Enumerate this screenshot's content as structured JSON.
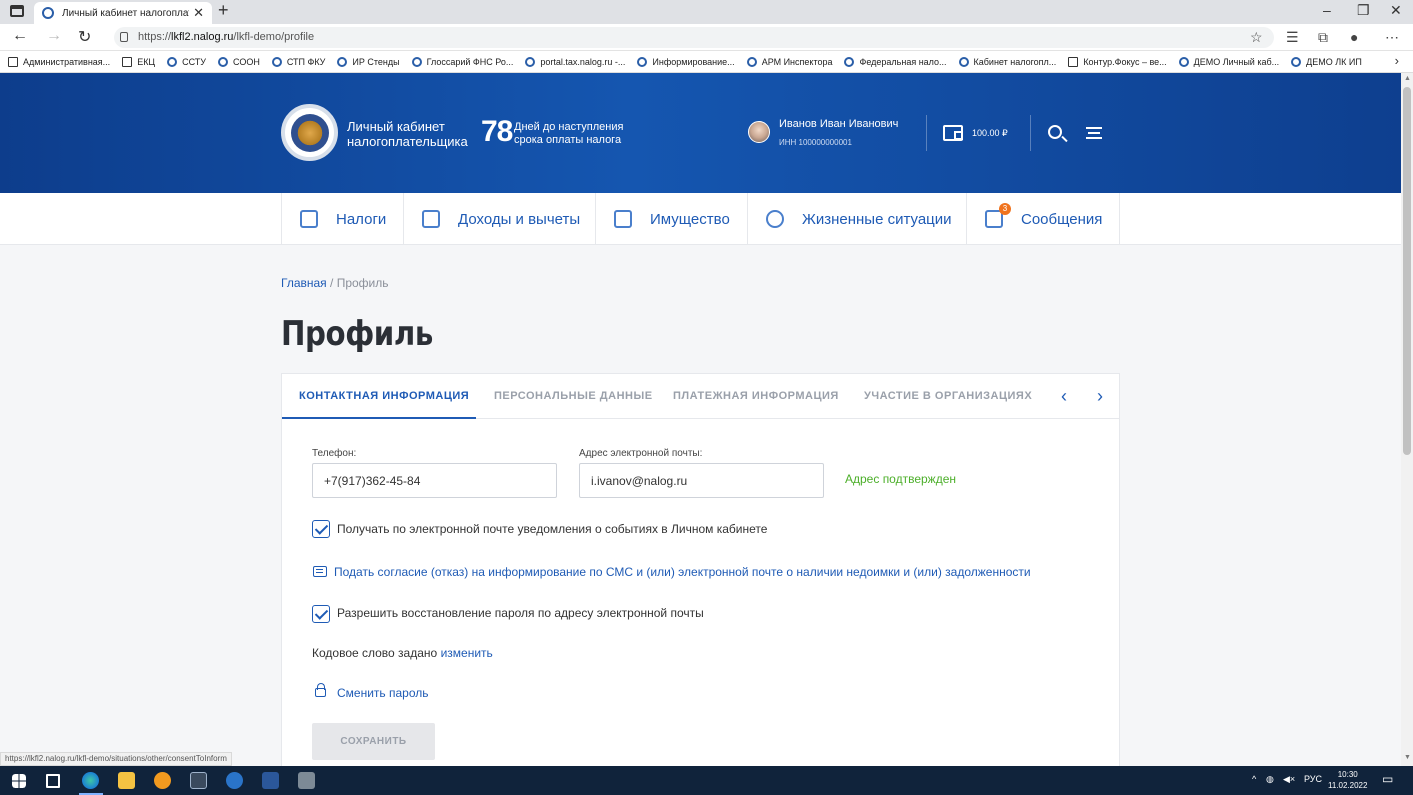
{
  "browser": {
    "tab_title": "Личный кабинет налогоплательщика",
    "url_prefix": "https://",
    "url_host": "lkfl2.nalog.ru",
    "url_path": "/lkfl-demo/profile",
    "bookmarks": [
      "Административная...",
      "ЕКЦ",
      "ССТУ",
      "СООН",
      "СТП ФКУ",
      "ИР Стенды",
      "Глоссарий ФНС Ро...",
      "portal.tax.nalog.ru -...",
      "Информирование...",
      "АРМ Инспектора",
      "Федеральная нало...",
      "Кабинет налогопл...",
      "Контур.Фокус – ве...",
      "ДЕМО Личный каб...",
      "ДЕМО ЛК ИП"
    ],
    "status_url": "https://lkfl2.nalog.ru/lkfl-demo/situations/other/consentToInform"
  },
  "header": {
    "brand_line1": "Личный кабинет",
    "brand_line2": "налогоплательщика",
    "days_count": "78",
    "days_line1": "Дней до наступления",
    "days_line2": "срока оплаты налога",
    "user_name": "Иванов Иван Иванович",
    "user_inn": "ИНН 100000000001",
    "balance": "100.00 ₽"
  },
  "nav": {
    "items": [
      {
        "label": "Налоги"
      },
      {
        "label": "Доходы и вычеты"
      },
      {
        "label": "Имущество"
      },
      {
        "label": "Жизненные ситуации"
      },
      {
        "label": "Сообщения",
        "badge": "3"
      }
    ]
  },
  "breadcrumb": {
    "home": "Главная",
    "separator": " / ",
    "current": "Профиль"
  },
  "page_title": "Профиль",
  "profile_tabs": [
    "КОНТАКТНАЯ ИНФОРМАЦИЯ",
    "ПЕРСОНАЛЬНЫЕ ДАННЫЕ",
    "ПЛАТЕЖНАЯ ИНФОРМАЦИЯ",
    "УЧАСТИЕ В ОРГАНИЗАЦИЯХ"
  ],
  "form": {
    "phone_label": "Телефон:",
    "phone_value": "+7(917)362-45-84",
    "email_label": "Адрес электронной почты:",
    "email_value": "i.ivanov@nalog.ru",
    "email_verified": "Адрес подтвержден",
    "notify_checkbox": "Получать по электронной почте уведомления о событиях в Личном кабинете",
    "consent_link": "Подать согласие (отказ) на информирование по СМС и (или) электронной почте о наличии недоимки и (или) задолженности",
    "restore_checkbox": "Разрешить восстановление пароля по адресу электронной почты",
    "codeword_text": "Кодовое слово задано",
    "codeword_link": "изменить",
    "change_password": "Сменить пароль",
    "save_button": "СОХРАНИТЬ"
  },
  "taskbar": {
    "lang": "РУС",
    "time": "10:30",
    "date": "11.02.2022"
  }
}
